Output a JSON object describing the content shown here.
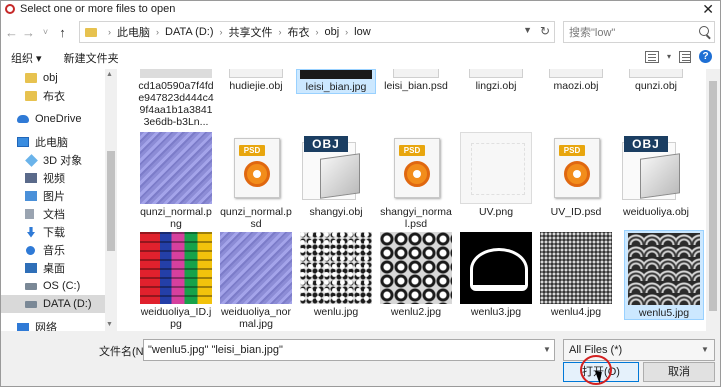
{
  "window": {
    "title": "Select one or more files to open",
    "close_label": "✕"
  },
  "nav": {
    "back": "←",
    "forward": "→",
    "recent": "˅",
    "up": "↑"
  },
  "address": {
    "crumbs": [
      "此电脑",
      "DATA (D:)",
      "共享文件",
      "布衣",
      "obj",
      "low"
    ]
  },
  "search": {
    "placeholder": "搜索\"low\""
  },
  "toolbar": {
    "organize": "组织 ▾",
    "new_folder": "新建文件夹",
    "help": "?"
  },
  "sidebar": {
    "items": [
      {
        "label": "obj",
        "icon": "folder-icon"
      },
      {
        "label": "布衣",
        "icon": "folder-icon"
      },
      {
        "label": "OneDrive",
        "icon": "cloud-icon"
      },
      {
        "label": "此电脑",
        "icon": "computer-icon"
      },
      {
        "label": "3D 对象",
        "icon": "3d-objects-icon"
      },
      {
        "label": "视频",
        "icon": "video-icon"
      },
      {
        "label": "图片",
        "icon": "pictures-icon"
      },
      {
        "label": "文档",
        "icon": "documents-icon"
      },
      {
        "label": "下载",
        "icon": "download-icon"
      },
      {
        "label": "音乐",
        "icon": "music-icon"
      },
      {
        "label": "桌面",
        "icon": "desktop-icon"
      },
      {
        "label": "OS (C:)",
        "icon": "drive-icon"
      },
      {
        "label": "DATA (D:)",
        "icon": "drive-icon",
        "selected": true
      },
      {
        "label": "网络",
        "icon": "network-icon"
      }
    ]
  },
  "files": {
    "row0": [
      {
        "name": "cd1a0590a7f4fde947823d444c49f4aa1b1a38413e6db-b3Ln..."
      },
      {
        "name": "hudiejie.obj"
      },
      {
        "name": "leisi_bian.jpg",
        "selected": true
      },
      {
        "name": "leisi_bian.psd"
      },
      {
        "name": "lingzi.obj"
      },
      {
        "name": "maozi.obj"
      },
      {
        "name": "qunzi.obj"
      }
    ],
    "row1": [
      {
        "name": "qunzi_normal.png"
      },
      {
        "name": "qunzi_normal.psd"
      },
      {
        "name": "shangyi.obj"
      },
      {
        "name": "shangyi_normal.psd"
      },
      {
        "name": "UV.png"
      },
      {
        "name": "UV_ID.psd"
      },
      {
        "name": "weiduoliya.obj"
      }
    ],
    "row2": [
      {
        "name": "weiduoliya_ID.jpg"
      },
      {
        "name": "weiduoliya_normal.jpg"
      },
      {
        "name": "wenlu.jpg"
      },
      {
        "name": "wenlu2.jpg"
      },
      {
        "name": "wenlu3.jpg"
      },
      {
        "name": "wenlu4.jpg"
      },
      {
        "name": "wenlu5.jpg",
        "selected": true
      }
    ],
    "badges": {
      "psd": "PSD",
      "obj": "OBJ"
    }
  },
  "footer": {
    "filename_label": "文件名(N):",
    "filename_value": "\"wenlu5.jpg\" \"leisi_bian.jpg\"",
    "filetype_value": "All Files  (*)",
    "open_label": "打开(O)",
    "cancel_label": "取消"
  }
}
